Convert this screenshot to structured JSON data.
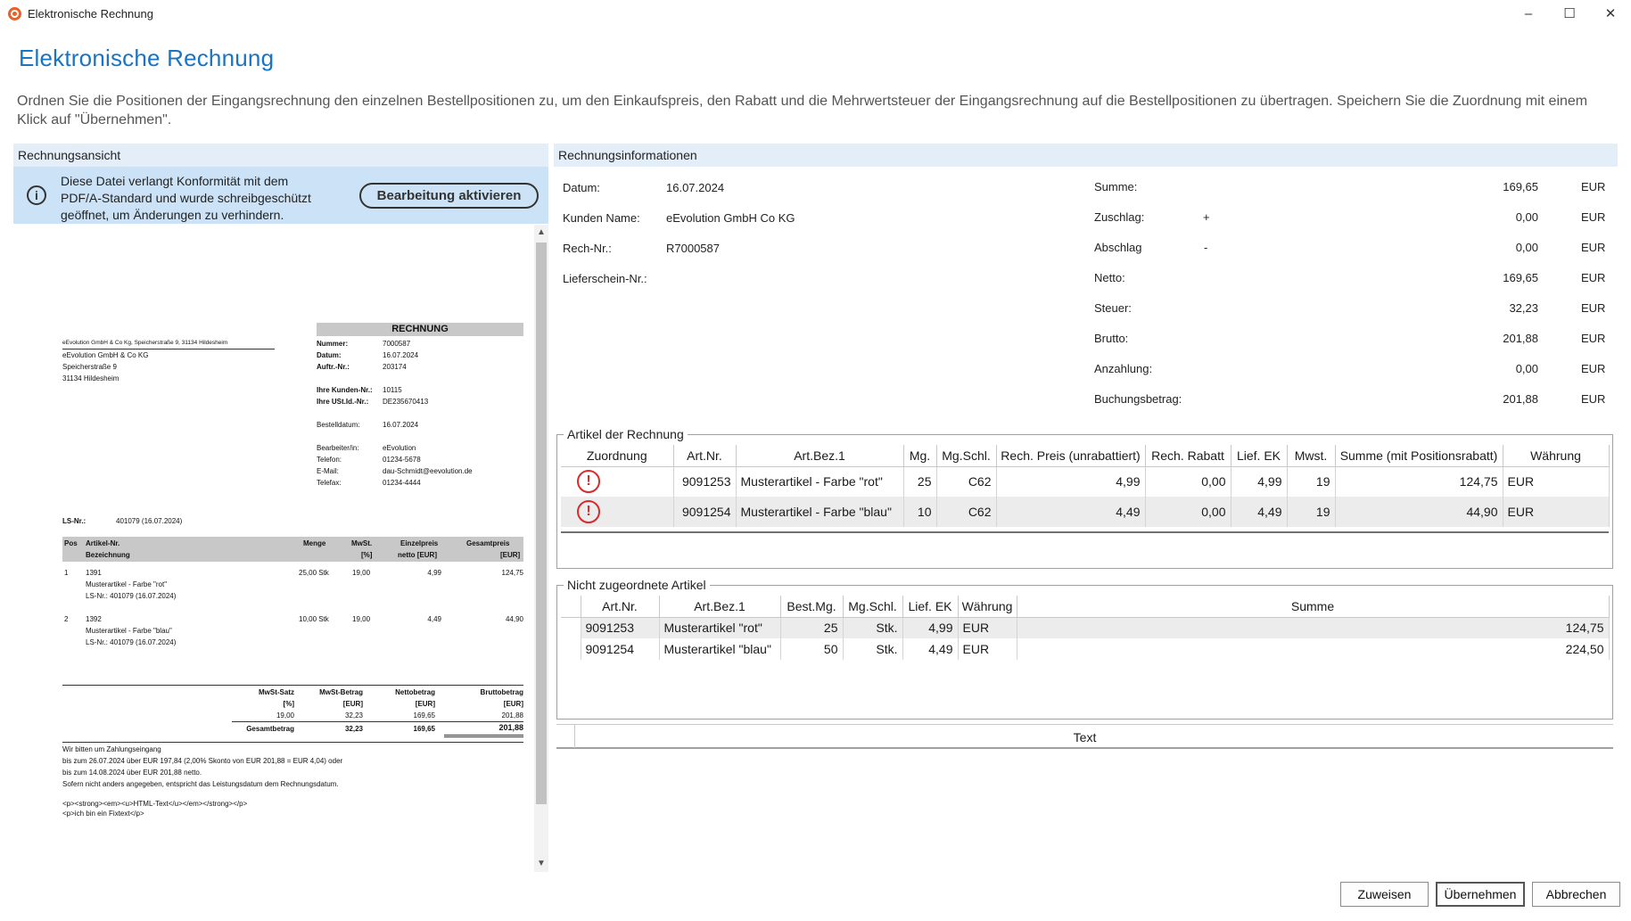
{
  "window": {
    "title": "Elektronische Rechnung",
    "minimize": "–",
    "maximize": "☐",
    "close": "✕"
  },
  "heading": "Elektronische Rechnung",
  "description": "Ordnen Sie die Positionen der Eingangsrechnung den einzelnen Bestellpositionen zu, um den Einkaufspreis, den Rabatt und die Mehrwertsteuer der Eingangsrechnung auf die Bestellpositionen zu übertragen. Speichern Sie die Zuordnung mit einem Klick auf \"Übernehmen\".",
  "left": {
    "header": "Rechnungsansicht",
    "info_text": "Diese Datei verlangt Konformität mit dem PDF/A-Standard und wurde schreibgeschützt geöffnet, um Änderungen zu verhindern.",
    "edit_button": "Bearbeitung aktivieren"
  },
  "pdf": {
    "sender_line": "eEvolution GmbH & Co Kg, Speicherstraße 9, 31134 Hildesheim",
    "recipient": [
      "eEvolution GmbH & Co KG",
      "Speicherstraße 9",
      "31134 Hildesheim"
    ],
    "doc_title": "RECHNUNG",
    "meta": [
      {
        "label": "Nummer:",
        "value": "7000587"
      },
      {
        "label": "Datum:",
        "value": "16.07.2024"
      },
      {
        "label": "Auftr.-Nr.:",
        "value": "203174"
      },
      {
        "label": "Ihre Kunden-Nr.:",
        "value": "10115"
      },
      {
        "label": "Ihre USt.Id.-Nr.:",
        "value": "DE235670413"
      },
      {
        "label": "Bestelldatum:",
        "value": "16.07.2024"
      },
      {
        "label": "Bearbeiter/in:",
        "value": "eEvolution"
      },
      {
        "label": "Telefon:",
        "value": "01234-5678"
      },
      {
        "label": "E-Mail:",
        "value": "dau-Schmidt@eevolution.de"
      },
      {
        "label": "Telefax:",
        "value": "01234-4444"
      }
    ],
    "ls_label": "LS-Nr.:",
    "ls_value": "401079 (16.07.2024)",
    "table_head": {
      "pos": "Pos",
      "artnr": "Artikel-Nr.",
      "bez": "Bezeichnung",
      "menge": "Menge",
      "mwst": "MwSt.",
      "mwst_unit": "[%]",
      "ep": "Einzelpreis",
      "ep_unit": "netto [EUR]",
      "gp": "Gesamtpreis",
      "gp_unit": "[EUR]"
    },
    "items": [
      {
        "pos": "1",
        "artnr": "1391",
        "bez": "Musterartikel - Farbe \"rot\"",
        "ls": "LS-Nr.: 401079 (16.07.2024)",
        "menge": "25,00 Stk",
        "mwst": "19,00",
        "ep": "4,99",
        "gp": "124,75"
      },
      {
        "pos": "2",
        "artnr": "1392",
        "bez": "Musterartikel - Farbe \"blau\"",
        "ls": "LS-Nr.: 401079 (16.07.2024)",
        "menge": "10,00 Stk",
        "mwst": "19,00",
        "ep": "4,49",
        "gp": "44,90"
      }
    ],
    "tax_head": {
      "satz": "MwSt-Satz",
      "satz_u": "[%]",
      "betrag": "MwSt-Betrag",
      "betrag_u": "[EUR]",
      "netto": "Nettobetrag",
      "netto_u": "[EUR]",
      "brutto": "Bruttobetrag",
      "brutto_u": "[EUR]"
    },
    "tax_row": {
      "satz": "19,00",
      "betrag": "32,23",
      "netto": "169,65",
      "brutto": "201,88"
    },
    "total_row": {
      "label": "Gesamtbetrag",
      "betrag": "32,23",
      "netto": "169,65",
      "brutto": "201,88"
    },
    "footer": [
      "Wir bitten um Zahlungseingang",
      "bis zum 26.07.2024 über EUR 197,84 (2,00% Skonto von EUR 201,88 = EUR 4,04) oder",
      "bis zum 14.08.2024 über EUR 201,88 netto.",
      "Sofern nicht anders angegeben, entspricht das Leistungsdatum dem Rechnungsdatum.",
      "<p><strong><em><u>HTML-Text</u></em></strong></p>",
      "<p>ich bin ein Fixtext</p>"
    ]
  },
  "right": {
    "header": "Rechnungsinformationen",
    "fields": [
      {
        "label": "Datum:",
        "value": "16.07.2024"
      },
      {
        "label": "Kunden Name:",
        "value": "eEvolution GmbH  Co KG"
      },
      {
        "label": "Rech-Nr.:",
        "value": "R7000587"
      },
      {
        "label": "Lieferschein-Nr.:",
        "value": ""
      }
    ],
    "amounts": [
      {
        "label": "Summe:",
        "sign": "",
        "value": "169,65",
        "currency": "EUR"
      },
      {
        "label": "Zuschlag:",
        "sign": "+",
        "value": "0,00",
        "currency": "EUR"
      },
      {
        "label": "Abschlag",
        "sign": "-",
        "value": "0,00",
        "currency": "EUR"
      },
      {
        "label": "Netto:",
        "sign": "",
        "value": "169,65",
        "currency": "EUR"
      },
      {
        "label": "Steuer:",
        "sign": "",
        "value": "32,23",
        "currency": "EUR"
      },
      {
        "label": "Brutto:",
        "sign": "",
        "value": "201,88",
        "currency": "EUR"
      },
      {
        "label": "Anzahlung:",
        "sign": "",
        "value": "0,00",
        "currency": "EUR"
      },
      {
        "label": "Buchungsbetrag:",
        "sign": "",
        "value": "201,88",
        "currency": "EUR"
      }
    ],
    "artikel_group": {
      "title": "Artikel der Rechnung",
      "columns": [
        "Zuordnung",
        "Art.Nr.",
        "Art.Bez.1",
        "Mg.",
        "Mg.Schl.",
        "Rech. Preis (unrabattiert)",
        "Rech. Rabatt",
        "Lief. EK",
        "Mwst.",
        "Summe (mit Positionsrabatt)",
        "Währung"
      ],
      "rows": [
        {
          "icon": "!",
          "artnr": "9091253",
          "bez": "Musterartikel  - Farbe \"rot\"",
          "mg": "25",
          "schl": "C62",
          "preis": "4,99",
          "rabatt": "0,00",
          "ek": "4,99",
          "mwst": "19",
          "summe": "124,75",
          "waehrung": "EUR"
        },
        {
          "icon": "!",
          "artnr": "9091254",
          "bez": "Musterartikel  - Farbe \"blau\"",
          "mg": "10",
          "schl": "C62",
          "preis": "4,49",
          "rabatt": "0,00",
          "ek": "4,49",
          "mwst": "19",
          "summe": "44,90",
          "waehrung": "EUR"
        }
      ]
    },
    "unassigned_group": {
      "title": "Nicht zugeordnete Artikel",
      "columns": [
        "Art.Nr.",
        "Art.Bez.1",
        "Best.Mg.",
        "Mg.Schl.",
        "Lief. EK",
        "Währung",
        "Summe"
      ],
      "rows": [
        {
          "artnr": "9091253",
          "bez": "Musterartikel \"rot\"",
          "mg": "25",
          "schl": "Stk.",
          "ek": "4,99",
          "waehrung": "EUR",
          "summe": "124,75"
        },
        {
          "artnr": "9091254",
          "bez": "Musterartikel \"blau\"",
          "mg": "50",
          "schl": "Stk.",
          "ek": "4,49",
          "waehrung": "EUR",
          "summe": "224,50"
        }
      ]
    },
    "text_header": "Text"
  },
  "buttons": {
    "assign": "Zuweisen",
    "apply": "Übernehmen",
    "cancel": "Abbrechen"
  }
}
